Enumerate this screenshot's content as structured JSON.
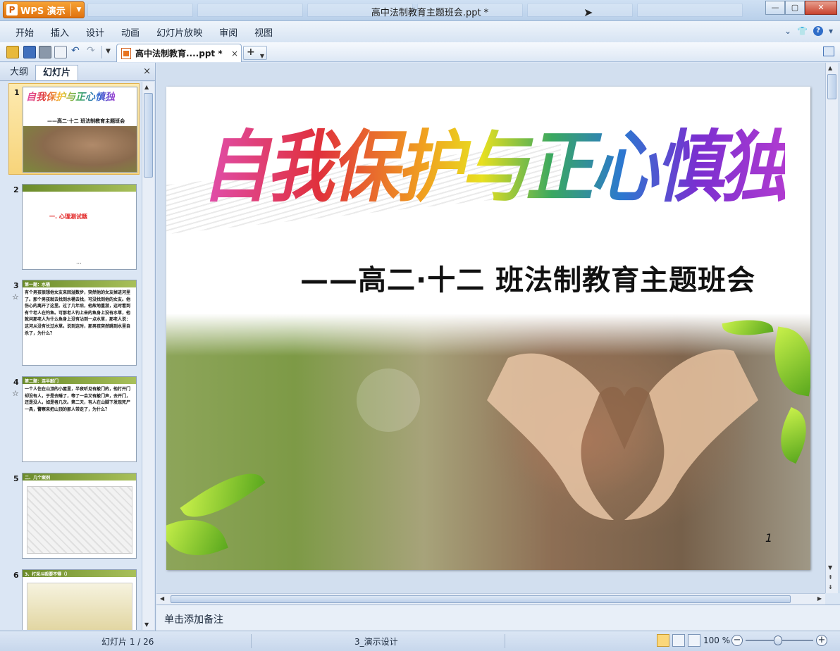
{
  "app": {
    "name": "WPS 演示",
    "logo_glyph": "P",
    "window_title": "高中法制教育主题班会.ppt *",
    "accent_color": "#e8821a"
  },
  "menu": [
    "开始",
    "插入",
    "设计",
    "动画",
    "幻灯片放映",
    "审阅",
    "视图"
  ],
  "menu_right": {
    "help_glyph": "?"
  },
  "document_tab": {
    "name": "高中法制教育....ppt *",
    "close_glyph": "×",
    "new_glyph": "+"
  },
  "left_panel": {
    "tabs": [
      "大纲",
      "幻灯片"
    ],
    "active_tab": "幻灯片",
    "close_glyph": "×",
    "slides": [
      {
        "number": "1",
        "title": "自我保护与正心慎独",
        "subtitle": "——高二·十二 班法制教育主题班会",
        "selected": true
      },
      {
        "number": "2",
        "red_text": "一. 心理测试题",
        "ellipsis": "...",
        "selected": false
      },
      {
        "number": "3",
        "star": "☆",
        "heading": "第一题：水桶",
        "body": "有个男孩很想他女友来回溢数步，突然他的女友掉进河里了。那个男孩就去找到水桶去找，可没找到他的女友。他伤心的离开了这里。过了几年后，他故地重游，这时看到有个老人在钓鱼。可那老人钓上来的鱼身上没有水草，他就问那老人为什么鱼身上没有沾到一点水草，那老人说：这河从没有长过水草。说到这时，那男孩突然跳到水里自杀了，为什么？",
        "selected": false
      },
      {
        "number": "4",
        "star": "☆",
        "heading": "第二题：连半敲门",
        "body": "一个人住在山顶的小屋里，半夜听见有敲门的，他打开门却没有人，于是去睡了，等了一会又有敲门声，去开门，还是没人，如是者几次。第二天，有人在山脚下发现死尸一具，警察来把山顶的那人带走了，为什么？",
        "selected": false
      },
      {
        "number": "5",
        "heading": "二、几个案例",
        "selected": false
      },
      {
        "number": "6",
        "heading": "3、打采斗殴要不得（）",
        "selected": false
      }
    ]
  },
  "slide": {
    "title": "自我保护与正心慎独",
    "subtitle": "——高二·十二 班法制教育主题班会",
    "page_number": "1"
  },
  "notes": {
    "placeholder": "单击添加备注"
  },
  "status": {
    "slide_counter": "幻灯片 1 / 26",
    "theme": "3_演示设计",
    "zoom": "100 %",
    "zoom_out_glyph": "−",
    "zoom_in_glyph": "+"
  }
}
